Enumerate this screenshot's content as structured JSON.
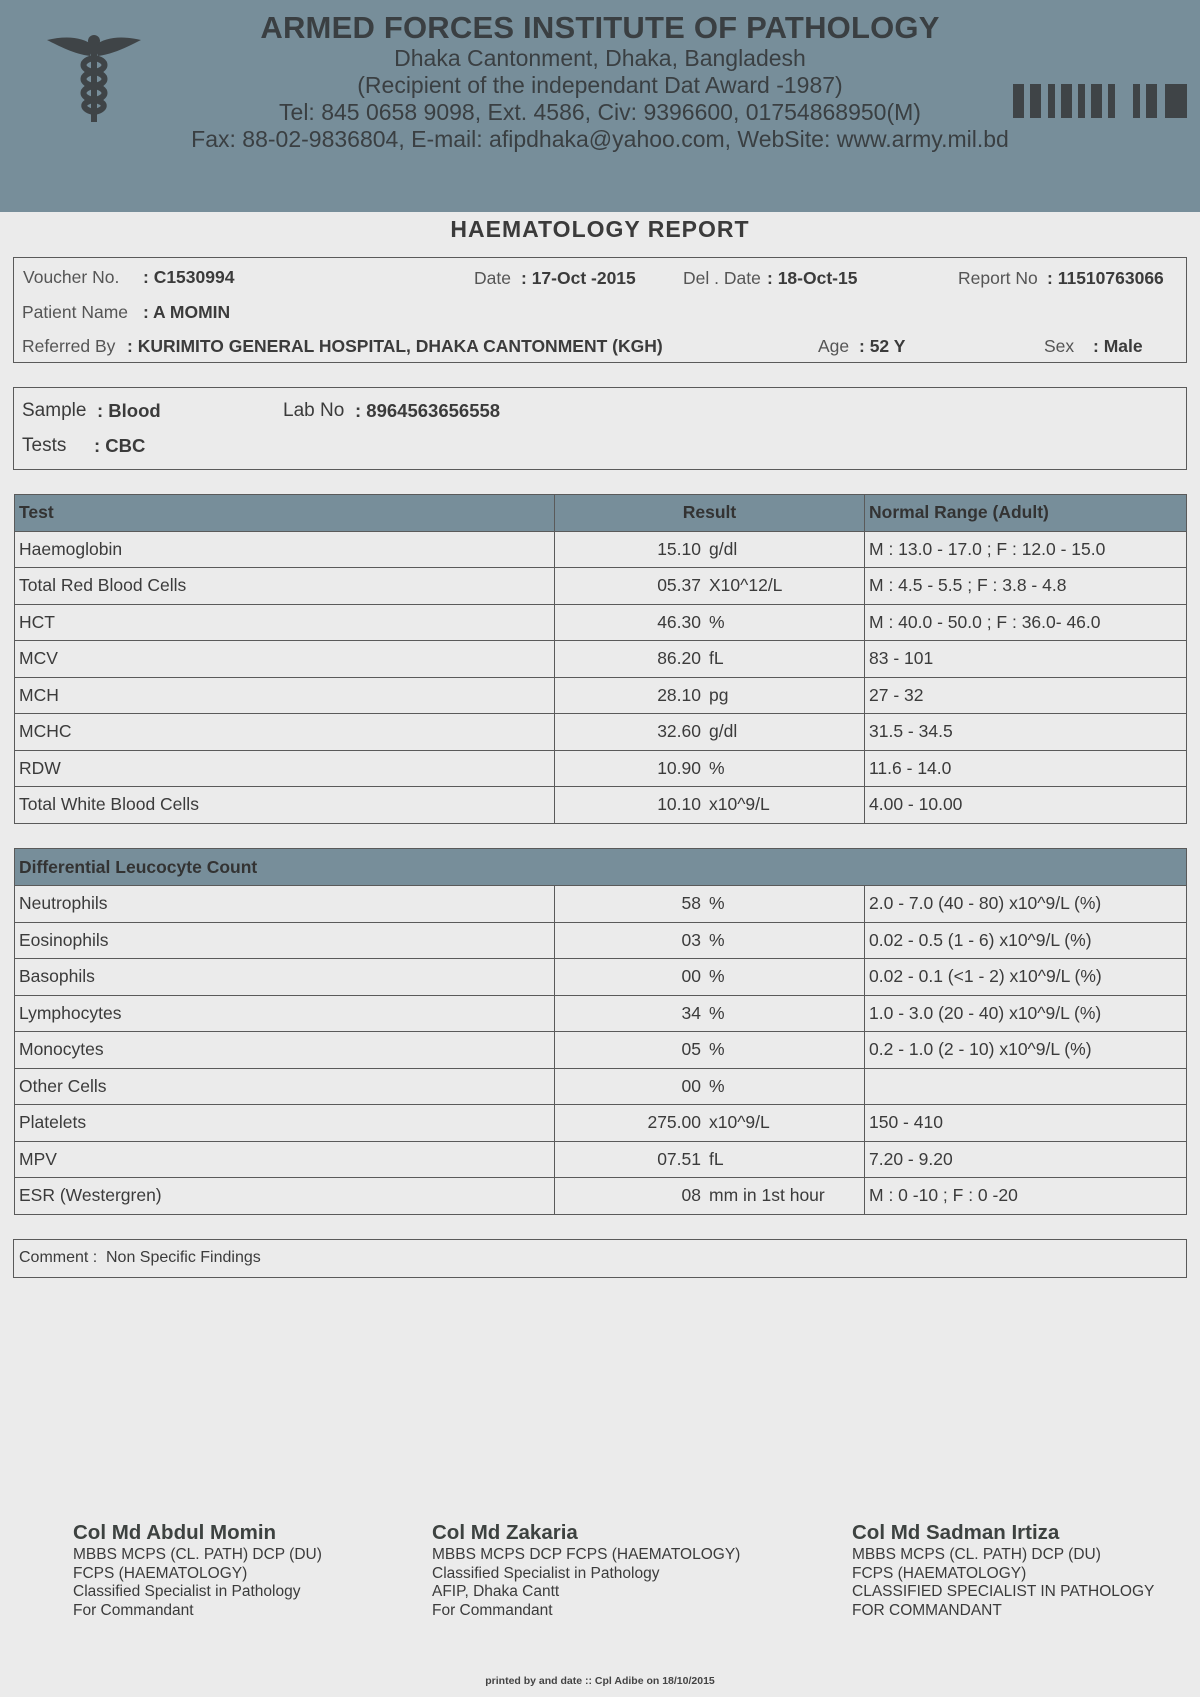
{
  "header": {
    "title": "ARMED FORCES INSTITUTE OF PATHOLOGY",
    "line1": "Dhaka Cantonment, Dhaka, Bangladesh",
    "line2": "(Recipient of the independant Dat Award -1987)",
    "line3": "Tel: 845 0658 9098, Ext. 4586, Civ: 9396600, 01754868950(M)",
    "line4": "Fax: 88-02-9836804, E-mail: afipdhaka@yahoo.com, WebSite: www.army.mil.bd",
    "logo_icon": "caduceus-icon",
    "barcode_icon": "barcode-icon",
    "color": "#778e9a"
  },
  "report_title": "HAEMATOLOGY REPORT",
  "info": {
    "voucher_label": "Voucher No.",
    "voucher_value": ":  C1530994",
    "date_label": "Date",
    "date_value": ": 17-Oct -2015",
    "del_date_label": "Del . Date",
    "del_date_value": ": 18-Oct-15",
    "report_label": "Report No",
    "report_value": ": 11510763066",
    "patient_label": "Patient Name",
    "patient_value": ":  A MOMIN",
    "referred_label": "Referred By",
    "referred_value": ": KURIMITO GENERAL HOSPITAL, DHAKA CANTONMENT (KGH)",
    "age_label": "Age",
    "age_value": ": 52 Y",
    "sex_label": "Sex",
    "sex_value": ": Male"
  },
  "sample": {
    "sample_label": "Sample",
    "sample_value": ": Blood",
    "lab_label": "Lab No",
    "lab_value": ": 8964563656558",
    "tests_label": "Tests",
    "tests_value": ": CBC"
  },
  "main_table": {
    "headers": [
      "Test",
      "Result",
      "Normal Range (Adult)"
    ],
    "rows": [
      {
        "test": "Haemoglobin",
        "value": "15.10",
        "unit": "g/dl",
        "range": "M : 13.0 - 17.0 ; F : 12.0 - 15.0"
      },
      {
        "test": "Total Red Blood Cells",
        "value": "05.37",
        "unit": "X10^12/L",
        "range": "M : 4.5 - 5.5 ; F : 3.8 - 4.8"
      },
      {
        "test": "HCT",
        "value": "46.30",
        "unit": "%",
        "range": "M : 40.0 - 50.0 ; F : 36.0- 46.0"
      },
      {
        "test": "MCV",
        "value": "86.20",
        "unit": "fL",
        "range": "83 - 101"
      },
      {
        "test": "MCH",
        "value": "28.10",
        "unit": "pg",
        "range": "27 - 32"
      },
      {
        "test": "MCHC",
        "value": "32.60",
        "unit": "g/dl",
        "range": "31.5 - 34.5"
      },
      {
        "test": "RDW",
        "value": "10.90",
        "unit": "%",
        "range": "11.6 - 14.0"
      },
      {
        "test": "Total White Blood Cells",
        "value": "10.10",
        "unit": "x10^9/L",
        "range": "4.00 - 10.00"
      }
    ]
  },
  "dlc_table": {
    "header": "Differential Leucocyte Count",
    "rows": [
      {
        "test": "Neutrophils",
        "value": "58",
        "unit": "%",
        "range": "2.0 - 7.0 (40 - 80)  x10^9/L (%)"
      },
      {
        "test": "Eosinophils",
        "value": "03",
        "unit": "%",
        "range": "0.02 - 0.5 (1 - 6)  x10^9/L (%)"
      },
      {
        "test": "Basophils",
        "value": "00",
        "unit": "%",
        "range": "0.02 - 0.1 (<1 - 2)  x10^9/L (%)"
      },
      {
        "test": "Lymphocytes",
        "value": "34",
        "unit": "%",
        "range": "1.0 - 3.0 (20 - 40)  x10^9/L (%)"
      },
      {
        "test": "Monocytes",
        "value": "05",
        "unit": "%",
        "range": "0.2 - 1.0 (2 - 10)  x10^9/L (%)"
      },
      {
        "test": "Other Cells",
        "value": "00",
        "unit": "%",
        "range": ""
      },
      {
        "test": "Platelets",
        "value": "275.00",
        "unit": "x10^9/L",
        "range": "150 - 410"
      },
      {
        "test": "MPV",
        "value": "07.51",
        "unit": "fL",
        "range": "7.20 - 9.20"
      },
      {
        "test": "ESR (Westergren)",
        "value": "08",
        "unit": "mm in 1st hour",
        "range": "M : 0 -10 ; F : 0 -20"
      }
    ]
  },
  "comment": {
    "label": "Comment :",
    "value": "Non Specific Findings"
  },
  "signatures": [
    {
      "name": "Col Md Abdul Momin",
      "lines": [
        "MBBS MCPS (CL. PATH) DCP (DU)",
        "FCPS (HAEMATOLOGY)",
        "Classified Specialist in Pathology",
        "For Commandant"
      ]
    },
    {
      "name": "Col Md Zakaria",
      "lines": [
        "MBBS MCPS DCP FCPS (HAEMATOLOGY)",
        "Classified Specialist in Pathology",
        "AFIP, Dhaka Cantt",
        "For Commandant"
      ]
    },
    {
      "name": "Col Md Sadman Irtiza",
      "lines": [
        "MBBS MCPS (CL. PATH) DCP (DU)",
        "FCPS (HAEMATOLOGY)",
        "CLASSIFIED SPECIALIST IN PATHOLOGY",
        "FOR COMMANDANT"
      ]
    }
  ],
  "footer": "printed by and date  :: Cpl Adibe on  18/10/2015"
}
